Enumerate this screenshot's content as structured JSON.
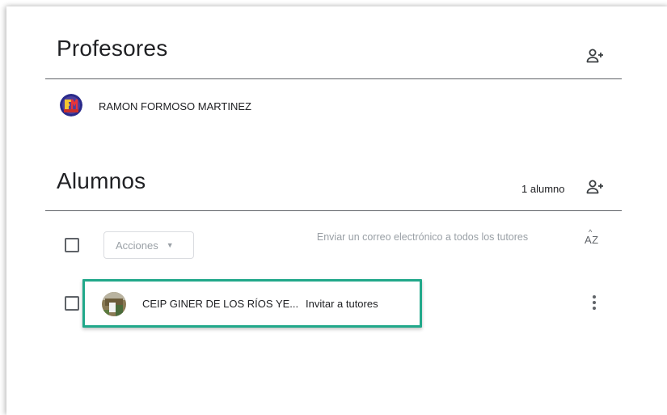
{
  "teachers": {
    "title": "Profesores",
    "items": [
      {
        "name": "RAMON FORMOSO MARTINEZ",
        "avatar_icon": "fm-logo-avatar"
      }
    ]
  },
  "students": {
    "title": "Alumnos",
    "count_label": "1 alumno",
    "actions_label": "Acciones",
    "email_all_label": "Enviar un correo electrónico a todos los tutores",
    "sort_label": "AZ",
    "items": [
      {
        "name": "CEIP GINER DE LOS RÍOS YE...",
        "invite_label": "Invitar a tutores",
        "avatar_icon": "photo-avatar"
      }
    ]
  },
  "colors": {
    "highlight": "#21a88a",
    "muted_text": "#9aa0a6",
    "icon": "#5f6368"
  }
}
